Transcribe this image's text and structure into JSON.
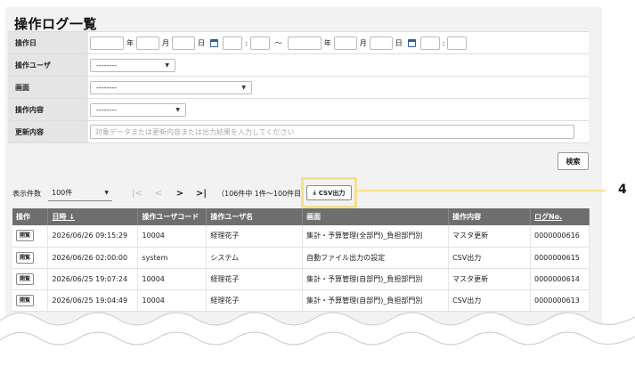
{
  "page": {
    "title": "操作ログ一覧"
  },
  "filters": {
    "operation_date": {
      "label": "操作日",
      "year_unit": "年",
      "month_unit": "月",
      "day_unit": "日",
      "time_sep": ":",
      "range_sep": "～"
    },
    "operation_user": {
      "label": "操作ユーザ",
      "value": "--------"
    },
    "screen": {
      "label": "画面",
      "value": "--------"
    },
    "operation_content": {
      "label": "操作内容",
      "value": "--------"
    },
    "update_content": {
      "label": "更新内容",
      "placeholder": "対象データまたは更新内容または出力結果を入力してください"
    }
  },
  "search_button": "検索",
  "toolbar": {
    "per_page_label": "表示件数",
    "per_page_value": "100件",
    "pager": {
      "first": "|<",
      "prev": "<",
      "next": ">",
      "last": ">|"
    },
    "count_text": "（106件中 1件～100件目）",
    "csv_label": "CSV出力"
  },
  "callout": {
    "number": "4"
  },
  "table": {
    "headers": {
      "action": "操作",
      "datetime": "日時 ↓",
      "user_code": "操作ユーザコード",
      "user_name": "操作ユーザ名",
      "screen": "画面",
      "content": "操作内容",
      "log_no": "ログNo."
    },
    "detail_label": "開覧",
    "rows": [
      {
        "datetime": "2026/06/26 09:15:29",
        "user_code": "10004",
        "user_name": "経理花子",
        "screen": "集計・予算管理(全部門)_負担部門別",
        "content": "マスタ更新",
        "log_no": "0000000616"
      },
      {
        "datetime": "2026/06/26 02:00:00",
        "user_code": "system",
        "user_name": "システム",
        "screen": "自動ファイル出力の設定",
        "content": "CSV出力",
        "log_no": "0000000615"
      },
      {
        "datetime": "2026/06/25 19:07:24",
        "user_code": "10004",
        "user_name": "経理花子",
        "screen": "集計・予算管理(自部門)_負担部門別",
        "content": "マスタ更新",
        "log_no": "0000000614"
      },
      {
        "datetime": "2026/06/25 19:04:49",
        "user_code": "10004",
        "user_name": "経理花子",
        "screen": "集計・予算管理(自部門)_負担部門別",
        "content": "CSV出力",
        "log_no": "0000000613"
      }
    ]
  }
}
